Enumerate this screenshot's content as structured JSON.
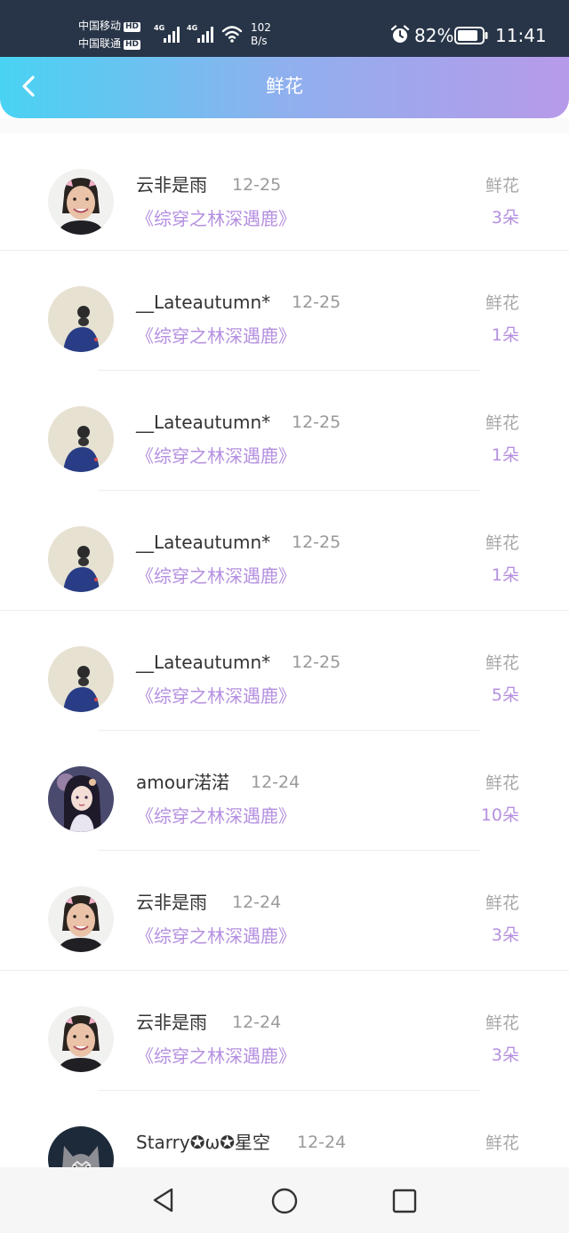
{
  "status_bar": {
    "carrier1": "中国移动",
    "carrier2": "中国联通",
    "hd_badge": "HD",
    "net_type": "4G",
    "speed_value": "102",
    "speed_unit": "B/s",
    "battery_pct": "82%",
    "time": "11:41"
  },
  "header": {
    "title": "鲜花",
    "gradient_start": "#49d3f3",
    "gradient_end": "#b79aea"
  },
  "list": {
    "items": [
      {
        "user": "云非是雨",
        "date": "12-25",
        "book": "《综穿之林深遇鹿》",
        "gift": "鲜花",
        "count": "3朵",
        "avatar": "smiling-woman"
      },
      {
        "user": "__Lateautumn*",
        "date": "12-25",
        "book": "《综穿之林深遇鹿》",
        "gift": "鲜花",
        "count": "1朵",
        "avatar": "girl-back-blue"
      },
      {
        "user": "__Lateautumn*",
        "date": "12-25",
        "book": "《综穿之林深遇鹿》",
        "gift": "鲜花",
        "count": "1朵",
        "avatar": "girl-back-blue"
      },
      {
        "user": "__Lateautumn*",
        "date": "12-25",
        "book": "《综穿之林深遇鹿》",
        "gift": "鲜花",
        "count": "1朵",
        "avatar": "girl-back-blue"
      },
      {
        "user": "__Lateautumn*",
        "date": "12-25",
        "book": "《综穿之林深遇鹿》",
        "gift": "鲜花",
        "count": "5朵",
        "avatar": "girl-back-blue"
      },
      {
        "user": "amour渃渃",
        "date": "12-24",
        "book": "《综穿之林深遇鹿》",
        "gift": "鲜花",
        "count": "10朵",
        "avatar": "anime-girl"
      },
      {
        "user": "云非是雨",
        "date": "12-24",
        "book": "《综穿之林深遇鹿》",
        "gift": "鲜花",
        "count": "3朵",
        "avatar": "smiling-woman"
      },
      {
        "user": "云非是雨",
        "date": "12-24",
        "book": "《综穿之林深遇鹿》",
        "gift": "鲜花",
        "count": "3朵",
        "avatar": "smiling-woman"
      },
      {
        "user": "Starry✪ω✪星空",
        "date": "12-24",
        "book": "",
        "gift": "鲜花",
        "count": "",
        "avatar": "cat"
      }
    ]
  },
  "colors": {
    "accent_purple": "#b590e0",
    "muted_gray": "#a8a8a8"
  }
}
